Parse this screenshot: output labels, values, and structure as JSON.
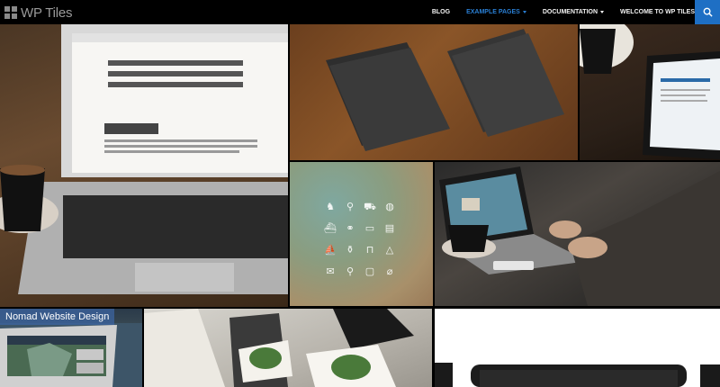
{
  "header": {
    "logo_text": "WP Tiles",
    "nav": [
      {
        "label": "BLOG",
        "active": false,
        "has_dropdown": false
      },
      {
        "label": "EXAMPLE PAGES",
        "active": true,
        "has_dropdown": true
      },
      {
        "label": "DOCUMENTATION",
        "active": false,
        "has_dropdown": true
      },
      {
        "label": "WELCOME TO WP TILES",
        "active": false,
        "has_dropdown": false
      }
    ],
    "search_icon": "search-icon"
  },
  "tiles": {
    "t1": {
      "image": "laptop-coffee-website-photo"
    },
    "t2": {
      "image": "business-cards-photo"
    },
    "t3": {
      "image": "tablet-coffee-photo"
    },
    "t4": {
      "image": "icon-set-blurred-background",
      "icons": [
        "africa-icon",
        "walker-icon",
        "car-icon",
        "globe-icon",
        "ship-icon",
        "binoculars-icon",
        "bus-icon",
        "train-icon",
        "boat-icon",
        "bottle-icon",
        "bed-icon",
        "cone-icon",
        "mail-icon",
        "search-icon",
        "chat-icon",
        "clip-icon"
      ]
    },
    "t5": {
      "image": "man-typing-laptop-photo"
    },
    "t6": {
      "image": "nomad-website-photo",
      "caption": "Nomad Website Design"
    },
    "t7": {
      "image": "stationery-mockup-photo"
    },
    "t8": {
      "image": "device-mockup-photo"
    }
  },
  "colors": {
    "topbar": "#000000",
    "accent": "#2a7fd4",
    "search_button": "#1e6fc4",
    "caption_bg": "rgba(60,100,160,0.75)"
  }
}
